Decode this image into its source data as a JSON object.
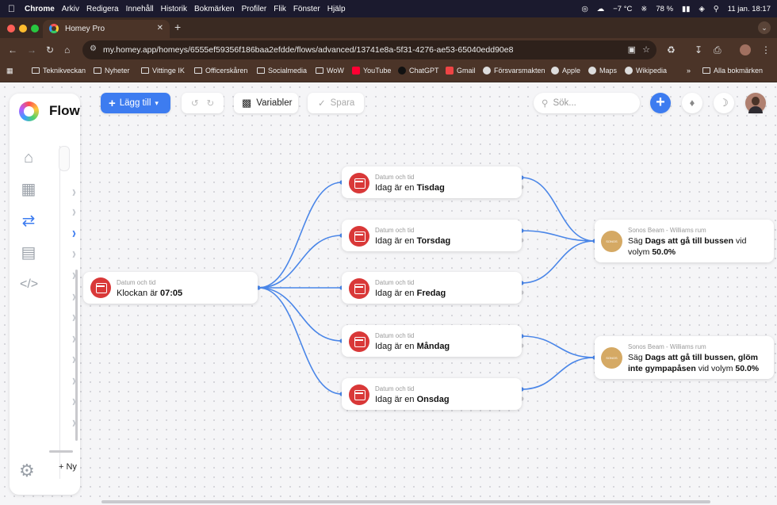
{
  "macos_menu": {
    "app": "Chrome",
    "items": [
      "Arkiv",
      "Redigera",
      "Innehåll",
      "Historik",
      "Bokmärken",
      "Profiler",
      "Flik",
      "Fönster",
      "Hjälp"
    ],
    "weather": "−7 °C",
    "battery": "78 %",
    "datetime": "11 jan.  18:17"
  },
  "browser": {
    "tab_title": "Homey Pro",
    "url": "my.homey.app/homeys/6555ef59356f186baa2efdde/flows/advanced/13741e8a-5f31-4276-ae53-65040edd90e8",
    "bookmarks": [
      "Teknikveckan",
      "Nyheter",
      "Vittinge IK",
      "Officerskåren",
      "Socialmedia",
      "WoW",
      "YouTube",
      "ChatGPT",
      "Gmail",
      "Försvarsmakten",
      "Apple",
      "Maps",
      "Wikipedia"
    ],
    "all_bookmarks": "Alla bokmärken"
  },
  "app": {
    "sidebar_title": "Flow",
    "new_flow_label": "Ny"
  },
  "toolbar": {
    "add_label": "Lägg till",
    "variables_label": "Variabler",
    "save_label": "Spara",
    "search_placeholder": "Sök..."
  },
  "flow": {
    "trigger": {
      "category": "Datum och tid",
      "prefix": "Klockan är ",
      "value": "07:05"
    },
    "conditions": [
      {
        "category": "Datum och tid",
        "prefix": "Idag är en ",
        "value": "Tisdag"
      },
      {
        "category": "Datum och tid",
        "prefix": "Idag är en ",
        "value": "Torsdag"
      },
      {
        "category": "Datum och tid",
        "prefix": "Idag är en ",
        "value": "Fredag"
      },
      {
        "category": "Datum och tid",
        "prefix": "Idag är en ",
        "value": "Måndag"
      },
      {
        "category": "Datum och tid",
        "prefix": "Idag är en ",
        "value": "Onsdag"
      }
    ],
    "actions": [
      {
        "device": "Sonos Beam - Williams rum",
        "prefix": "Säg ",
        "message": "Dags att gå till bussen",
        "middle": " vid volym ",
        "volume": "50.0%"
      },
      {
        "device": "Sonos Beam - Williams rum",
        "prefix": "Säg ",
        "message": "Dags att gå till bussen, glöm inte gympapåsen",
        "middle": " vid volym ",
        "volume": "50.0%"
      }
    ],
    "sonos_icon_text": "SONOS"
  },
  "colors": {
    "accent": "#3d7cf0",
    "trigger_red": "#d93838",
    "sonos_gold": "#d5a964",
    "wire": "#4a86e8"
  }
}
